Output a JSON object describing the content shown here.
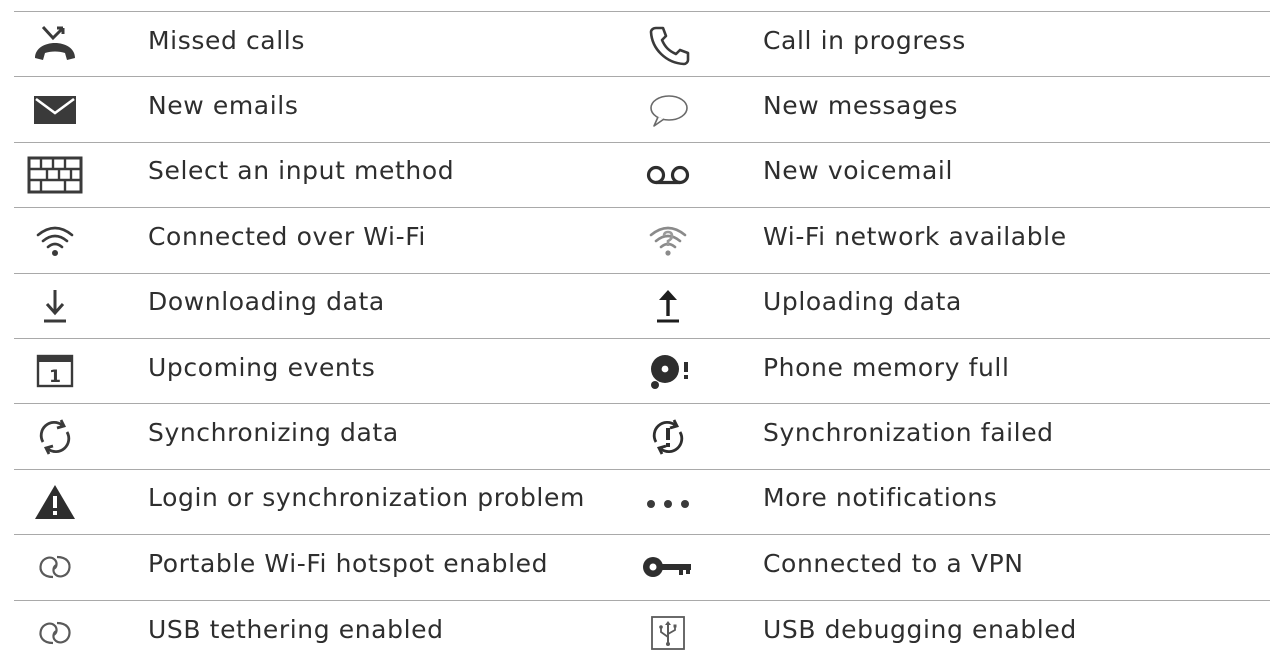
{
  "rows": [
    {
      "left": {
        "icon": "missed-call-icon",
        "label": "Missed calls"
      },
      "right": {
        "icon": "call-in-progress-icon",
        "label": "Call in progress"
      }
    },
    {
      "left": {
        "icon": "email-icon",
        "label": "New emails"
      },
      "right": {
        "icon": "message-bubble-icon",
        "label": "New messages"
      }
    },
    {
      "left": {
        "icon": "keyboard-icon",
        "label": "Select an input method"
      },
      "right": {
        "icon": "voicemail-icon",
        "label": "New voicemail"
      }
    },
    {
      "left": {
        "icon": "wifi-connected-icon",
        "label": "Connected over Wi-Fi"
      },
      "right": {
        "icon": "wifi-available-icon",
        "label": "Wi-Fi network available"
      }
    },
    {
      "left": {
        "icon": "download-icon",
        "label": "Downloading data"
      },
      "right": {
        "icon": "upload-icon",
        "label": "Uploading data"
      }
    },
    {
      "left": {
        "icon": "calendar-icon",
        "label": "Upcoming events",
        "icon_text": "1"
      },
      "right": {
        "icon": "memory-full-icon",
        "label": "Phone memory full"
      }
    },
    {
      "left": {
        "icon": "sync-icon",
        "label": "Synchronizing data"
      },
      "right": {
        "icon": "sync-failed-icon",
        "label": "Synchronization failed"
      }
    },
    {
      "left": {
        "icon": "warning-icon",
        "label": "Login or synchronization problem"
      },
      "right": {
        "icon": "more-dots-icon",
        "label": "More notifications"
      }
    },
    {
      "left": {
        "icon": "hotspot-icon",
        "label": "Portable Wi-Fi hotspot enabled"
      },
      "right": {
        "icon": "vpn-key-icon",
        "label": "Connected to a VPN"
      }
    },
    {
      "left": {
        "icon": "usb-tethering-icon",
        "label": "USB tethering enabled"
      },
      "right": {
        "icon": "usb-debugging-icon",
        "label": "USB debugging enabled"
      }
    }
  ],
  "colors": {
    "icon": "#3a3a3a",
    "text": "#2e2e2e",
    "rule": "#a9a9a9"
  }
}
